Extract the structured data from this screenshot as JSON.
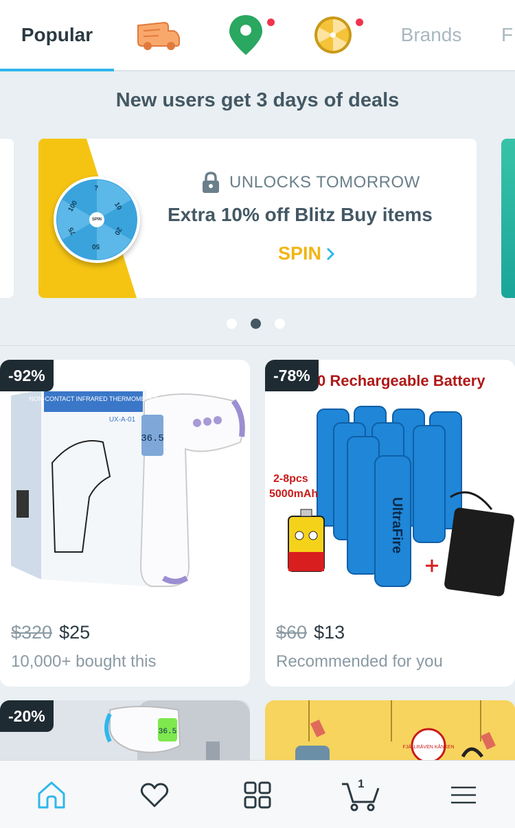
{
  "tabs": {
    "popular": "Popular",
    "brands": "Brands",
    "cut_off": "F",
    "icons": [
      "truck-icon",
      "location-pin-icon",
      "prize-wheel-icon"
    ]
  },
  "deals": {
    "title": "New users get 3 days of deals"
  },
  "promo": {
    "lock_label": "UNLOCKS TOMORROW",
    "headline": "Extra 10% off Blitz Buy items",
    "cta": "SPIN",
    "wheel_hub": "SPIN",
    "wheel_numbers": [
      "?",
      "10",
      "20",
      "50",
      "75",
      "100"
    ]
  },
  "carousel": {
    "count": 3,
    "active_index": 1
  },
  "products": [
    {
      "discount": "-92%",
      "old_price": "$320",
      "price": "$25",
      "sub": "10,000+ bought this",
      "image_text": {
        "box_title": "NON-CONTACT INFRARED THERMOMETER",
        "model": "UX-A-01",
        "reading": "36.5"
      }
    },
    {
      "discount": "-78%",
      "old_price": "$60",
      "price": "$13",
      "sub": "Recommended for you",
      "image_text": {
        "banner": "0 Rechargeable Battery",
        "spec1": "2-8pcs",
        "spec2": "5000mAh",
        "brand": "UltraFire"
      }
    },
    {
      "discount": "-20%",
      "image_text": {
        "reading": "36.5"
      }
    },
    {
      "image_text": {
        "brand": "FJÄLLRÄVEN KÅNKEN"
      }
    }
  ],
  "bottom_nav": {
    "items": [
      "home-icon",
      "heart-icon",
      "grid-icon",
      "cart-icon",
      "menu-icon"
    ],
    "cart_count": "1"
  },
  "colors": {
    "accent": "#2fb7ec",
    "promo_yellow": "#f5c413",
    "spin": "#f0b513",
    "badge": "#1f2b33",
    "dot": "#f0344e"
  }
}
